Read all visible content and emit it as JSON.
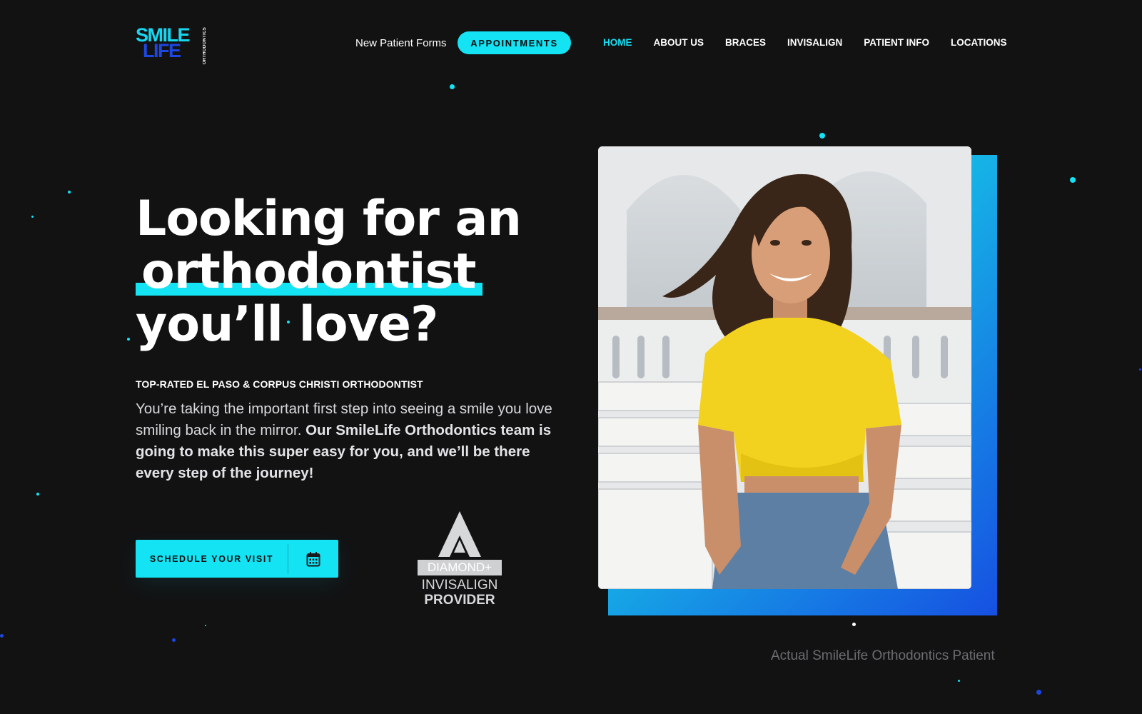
{
  "header": {
    "logo": {
      "line1": "SMILE",
      "line2": "LIFE",
      "line3": "ORTHODONTICS"
    },
    "forms_link": "New Patient Forms",
    "appointments_button": "APPOINTMENTS",
    "nav": [
      {
        "label": "HOME",
        "active": true
      },
      {
        "label": "ABOUT US",
        "active": false
      },
      {
        "label": "BRACES",
        "active": false
      },
      {
        "label": "INVISALIGN",
        "active": false
      },
      {
        "label": "PATIENT INFO",
        "active": false
      },
      {
        "label": "LOCATIONS",
        "active": false
      }
    ]
  },
  "hero": {
    "title_line1": "Looking for an",
    "title_line2": "orthodontist",
    "title_line3": "you’ll love?",
    "subheading": "TOP-RATED EL PASO & CORPUS CHRISTI ORTHODONTIST",
    "paragraph_plain": "You’re taking the important first step into seeing a smile you love smiling back in the mirror. ",
    "paragraph_bold": "Our SmileLife Orthodontics team is going to make this super easy for you, and we’ll be there every step of the journey!",
    "cta_label": "SCHEDULE YOUR VISIT",
    "cta_icon": "calendar-icon"
  },
  "badge": {
    "line1": "DIAMOND+",
    "line2": "INVISALIGN",
    "line3": "PROVIDER"
  },
  "photo": {
    "caption": "Actual SmileLife Orthodontics Patient"
  },
  "colors": {
    "background": "#121213",
    "accent_cyan": "#13e3f3",
    "accent_blue": "#1d47e0"
  }
}
